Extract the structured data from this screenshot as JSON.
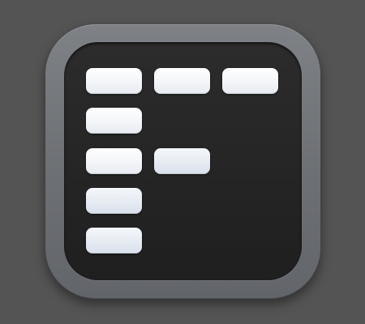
{
  "icon": {
    "name": "list-layout-icon",
    "colors": {
      "background": "#545454",
      "bezel": "#707377",
      "screen": "#262626",
      "tile": "#f3f5f8",
      "tile_tint": "#dde4ee"
    }
  }
}
